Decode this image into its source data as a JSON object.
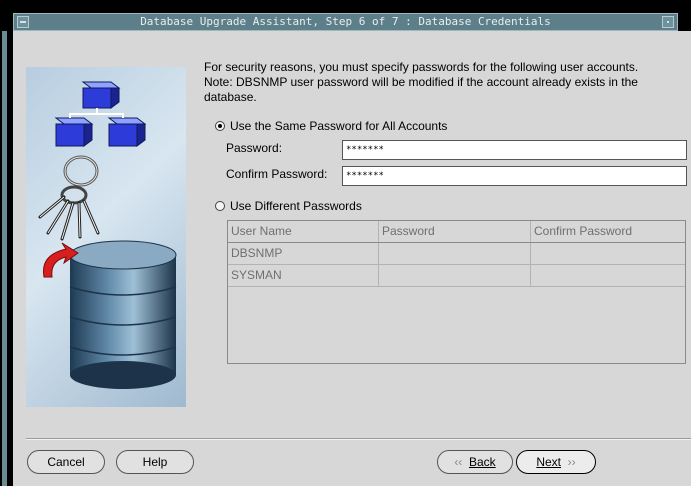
{
  "window": {
    "title": "Database Upgrade Assistant, Step 6 of 7 : Database Credentials"
  },
  "intro": {
    "line1": "For security reasons, you must specify passwords for the following user accounts.",
    "line2": "Note: DBSNMP user password will be modified if the account already exists in the",
    "line3": "database."
  },
  "options": {
    "same_label": "Use the Same Password for All Accounts",
    "different_label": "Use Different Passwords",
    "selected": "same"
  },
  "fields": {
    "password_label": "Password:",
    "password_value": "*******",
    "confirm_label": "Confirm Password:",
    "confirm_value": "*******"
  },
  "table": {
    "columns": [
      "User Name",
      "Password",
      "Confirm Password"
    ],
    "rows": [
      [
        "DBSNMP",
        "",
        ""
      ],
      [
        "SYSMAN",
        "",
        ""
      ]
    ]
  },
  "buttons": {
    "cancel": "Cancel",
    "help": "Help",
    "back": "Back",
    "next": "Next"
  },
  "colors": {
    "titlebar": "#5c7f8a",
    "dialog_bg": "#d7d7d7"
  }
}
